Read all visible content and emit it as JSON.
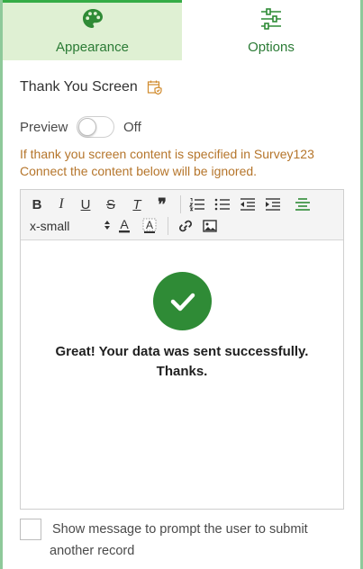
{
  "tabs": [
    {
      "label": "Appearance",
      "icon": "palette-icon",
      "active": true
    },
    {
      "label": "Options",
      "icon": "sliders-icon",
      "active": false
    }
  ],
  "section": {
    "title": "Thank You Screen",
    "icon": "calendar-shield-icon"
  },
  "preview": {
    "label": "Preview",
    "state": "Off",
    "enabled": false
  },
  "warning": "If thank you screen content is specified in Survey123 Connect the content below will be ignored.",
  "toolbar": {
    "bold": "B",
    "italic": "I",
    "underline": "U",
    "strike": "S",
    "clear_format": "T",
    "quote": "❞",
    "font_size": "x-small"
  },
  "content": {
    "message_line1": "Great! Your data was sent successfully.",
    "message_line2": "Thanks."
  },
  "bottom_checkbox": {
    "line1": "Show message to prompt the user to submit",
    "line2": "another record",
    "checked": false
  },
  "colors": {
    "accent": "#35ac46",
    "success": "#2f8b36",
    "warning": "#b5752b",
    "tab_active_bg": "#dff0d3"
  }
}
